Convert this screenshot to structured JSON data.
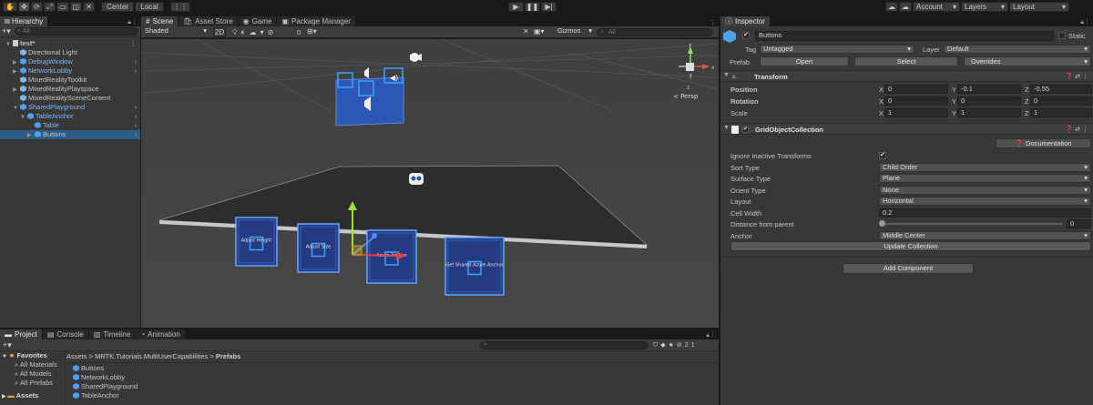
{
  "toolbar": {
    "tools": [
      "hand",
      "move",
      "rotate",
      "scale",
      "rect",
      "transform",
      "custom"
    ],
    "pivot": "Center",
    "space": "Local",
    "play": [
      "play-icon",
      "pause-icon",
      "step-icon"
    ],
    "account": "Account",
    "layers": "Layers",
    "layout": "Layout"
  },
  "hierarchy": {
    "tab": "Hierarchy",
    "search": "All",
    "items": [
      {
        "label": "test*",
        "depth": 0,
        "kind": "scene",
        "arrow": "▼",
        "blue": false,
        "selected": false
      },
      {
        "label": "Directional Light",
        "depth": 1,
        "kind": "cube",
        "arrow": "",
        "blue": false,
        "selected": false
      },
      {
        "label": "DebugWindow",
        "depth": 1,
        "kind": "cubeb",
        "arrow": "▶",
        "blue": true,
        "selected": false,
        "more": true
      },
      {
        "label": "NetworkLobby",
        "depth": 1,
        "kind": "cubeb",
        "arrow": "▶",
        "blue": true,
        "selected": false,
        "more": true
      },
      {
        "label": "MixedRealityToolkit",
        "depth": 1,
        "kind": "cube",
        "arrow": "",
        "blue": false,
        "selected": false
      },
      {
        "label": "MixedRealityPlayspace",
        "depth": 1,
        "kind": "cube",
        "arrow": "▶",
        "blue": false,
        "selected": false
      },
      {
        "label": "MixedRealitySceneContent",
        "depth": 1,
        "kind": "cube",
        "arrow": "",
        "blue": false,
        "selected": false
      },
      {
        "label": "SharedPlayground",
        "depth": 1,
        "kind": "cubeb",
        "arrow": "▼",
        "blue": true,
        "selected": false,
        "more": true
      },
      {
        "label": "TableAnchor",
        "depth": 2,
        "kind": "cubeb",
        "arrow": "▼",
        "blue": true,
        "selected": false,
        "more": true
      },
      {
        "label": "Table",
        "depth": 3,
        "kind": "cubeb",
        "arrow": "",
        "blue": true,
        "selected": false,
        "more": true
      },
      {
        "label": "Buttons",
        "depth": 3,
        "kind": "cubeb",
        "arrow": "▶",
        "blue": false,
        "selected": true,
        "more": true
      }
    ]
  },
  "scene": {
    "tabs": [
      "Scene",
      "Asset Store",
      "Game",
      "Package Manager"
    ],
    "shading": "Shaded",
    "mode2d": "2D",
    "gizmos": "Gizmos",
    "search": "All",
    "hidden_count": "0",
    "persp": "< Persp",
    "axes": {
      "x": "x",
      "y": "y",
      "z": "z"
    },
    "cards": [
      {
        "label": "Adjust Height"
      },
      {
        "label": "Adjust Size"
      },
      {
        "label": "Azure Anchor"
      },
      {
        "label": "Get Shared Azure Anchor"
      }
    ]
  },
  "inspector": {
    "tab": "Inspector",
    "name": "Buttons",
    "static": "Static",
    "tag_label": "Tag",
    "tag": "Untagged",
    "layer_label": "Layer",
    "layer": "Default",
    "prefab_label": "Prefab",
    "open": "Open",
    "select": "Select",
    "overrides": "Overrides",
    "transform": {
      "title": "Transform",
      "rows": [
        {
          "label": "Position",
          "x": "0",
          "y": "-0.1",
          "z": "-0.55",
          "bold": true
        },
        {
          "label": "Rotation",
          "x": "0",
          "y": "0",
          "z": "0",
          "bold": true
        },
        {
          "label": "Scale",
          "x": "1",
          "y": "1",
          "z": "1",
          "bold": false
        }
      ]
    },
    "grid": {
      "title": "GridObjectCollection",
      "doc": "Documentation",
      "fields": [
        {
          "label": "Ignore Inactive Transforms",
          "type": "check",
          "value": "✔"
        },
        {
          "label": "Sort Type",
          "type": "drop",
          "value": "Child Order"
        },
        {
          "label": "Surface Type",
          "type": "drop",
          "value": "Plane"
        },
        {
          "label": "Orient Type",
          "type": "drop",
          "value": "None"
        },
        {
          "label": "Layout",
          "type": "drop",
          "value": "Horizontal"
        },
        {
          "label": "Cell Width",
          "type": "field",
          "value": "0.2"
        },
        {
          "label": "Distance from parent",
          "type": "slider",
          "value": "0"
        },
        {
          "label": "Anchor",
          "type": "drop",
          "value": "Middle Center"
        }
      ],
      "update": "Update Collection"
    },
    "add": "Add Component"
  },
  "project": {
    "tabs": [
      "Project",
      "Console",
      "Timeline",
      "Animation"
    ],
    "favorites": "Favorites",
    "fav_items": [
      "All Materials",
      "All Models",
      "All Prefabs"
    ],
    "assets_root": "Assets",
    "breadcrumb": [
      "Assets",
      "MRTK.Tutorials.MultiUserCapabilities",
      "Prefabs"
    ],
    "files": [
      "Buttons",
      "NetworkLobby",
      "SharedPlayground",
      "TableAnchor"
    ],
    "count": "21"
  }
}
